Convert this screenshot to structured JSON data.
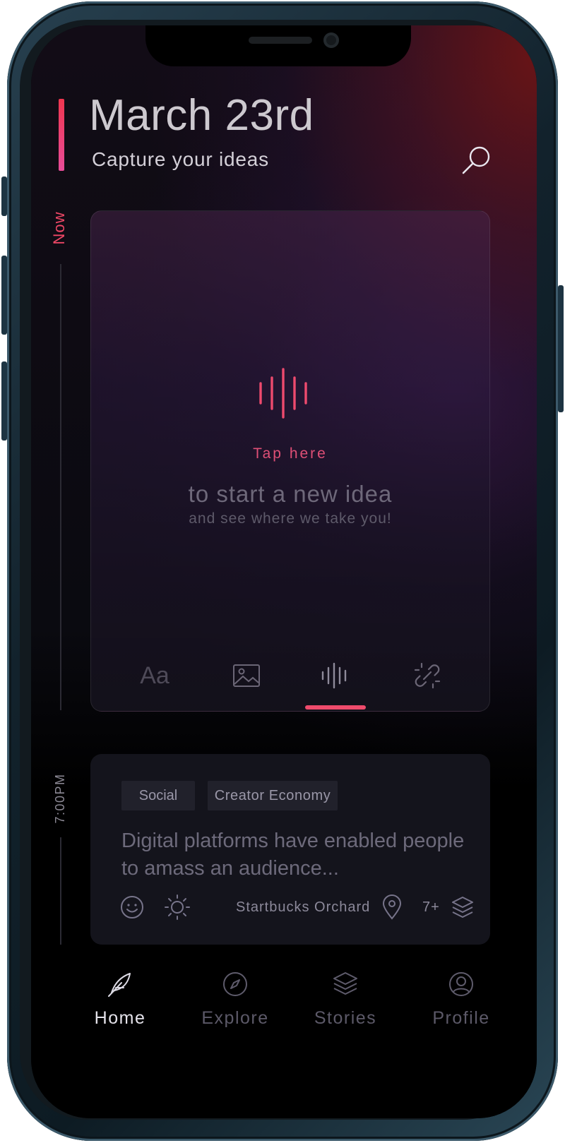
{
  "header": {
    "date_title": "March 23rd",
    "subtitle": "Capture your ideas"
  },
  "timeline": {
    "now_label": "Now",
    "entry_time": "7:00PM"
  },
  "capture_card": {
    "tap_text": "Tap here",
    "prompt_main": "to start a new idea",
    "prompt_sub": "and see where we take you!",
    "text_type_label": "Aa",
    "selected_type": "audio"
  },
  "entry": {
    "tags": [
      "Social",
      "Creator Economy"
    ],
    "text": "Digital platforms have enabled people to amass an audience...",
    "location": "Startbucks Orchard",
    "count": "7+"
  },
  "nav": {
    "items": [
      {
        "label": "Home",
        "icon": "feather-icon",
        "active": true
      },
      {
        "label": "Explore",
        "icon": "compass-icon",
        "active": false
      },
      {
        "label": "Stories",
        "icon": "layers-icon",
        "active": false
      },
      {
        "label": "Profile",
        "icon": "user-icon",
        "active": false
      }
    ]
  },
  "colors": {
    "accent": "#ef4b6c",
    "background": "#000000",
    "card": "#14141c",
    "text_primary": "#cdc9cf",
    "text_muted": "#6d6a7b"
  }
}
